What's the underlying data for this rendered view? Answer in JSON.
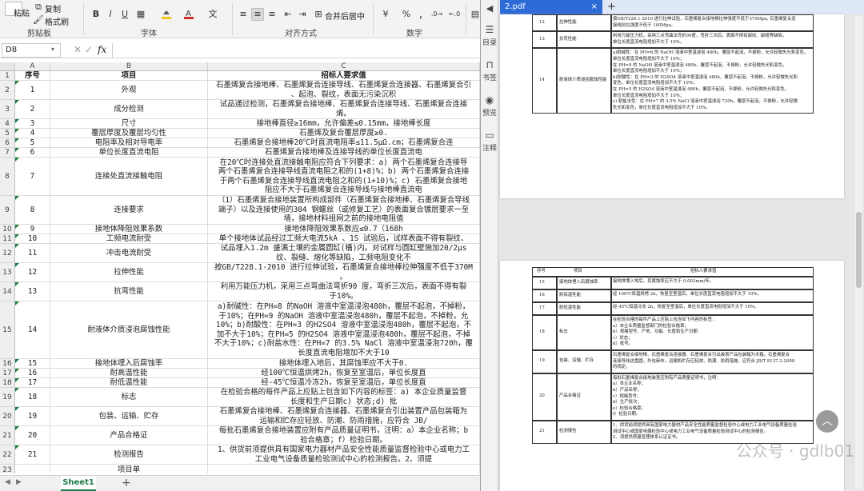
{
  "ribbon": {
    "paste": "粘贴",
    "copy": "复制",
    "format_painter": "格式刷",
    "clipboard_group": "剪贴板",
    "font_group": "字体",
    "align_group": "对齐方式",
    "number_group": "数字",
    "merge": "合并后居中",
    "percent": "%",
    "comma": ",",
    "font_color": "#d02c2c",
    "fill_color": "#f5c518"
  },
  "formula_bar": {
    "cell_ref": "D8",
    "value": ""
  },
  "columns": [
    "A",
    "B",
    "C"
  ],
  "rows": [
    {
      "n": "1",
      "a": "序号",
      "b": "项目",
      "c": "招标人要求值"
    },
    {
      "n": "2",
      "a": "1",
      "b": "外观",
      "c": "石墨烯复合接地棒、石墨烯复合连接导线、石墨烯复合连接器、石墨烯复合引",
      "c2": "、起泡、裂纹，表面无污染沉积"
    },
    {
      "n": "3",
      "a": "2",
      "b": "成分检测",
      "c": "试品通过检测，石墨烯复合接地棒、石墨烯复合连接导线、石墨烯复合连接",
      "c2": "烯。"
    },
    {
      "n": "4",
      "a": "3",
      "b": "尺寸",
      "c": "接地棒直径≥16mm，允许偏差≤0.15mm，接地棒长度"
    },
    {
      "n": "5",
      "a": "4",
      "b": "覆层厚度及覆层均匀性",
      "c": "石墨烯及复合覆层厚度≥0."
    },
    {
      "n": "6",
      "a": "5",
      "b": "电阻率及相对导电率",
      "c": "石墨烯复合接地棒20℃时直流电阻率≤11.5μΩ.cm；石墨烯复合连"
    },
    {
      "n": "7",
      "a": "6",
      "b": "单位长度直流电阻",
      "c": "石墨烯复合接地棒及连接导线的单位长度直流电"
    },
    {
      "n": "8",
      "a": "7",
      "b": "连接处直流接触电阻",
      "c": "在20℃时连接处直流接触电阻应符合下列要求：a) 两个石墨烯复合连接导",
      "c2": "两个石墨烯复合连接导线直流电阻之和的(1+8)%；b) 两个石墨烯复合连接",
      "c3": "于两个石墨烯复合连接导线直流电阻之和的(1+10)%；c) 石墨烯复合接地",
      "c4": "阻应不大于石墨烯复合连接导线与接地棒直流电"
    },
    {
      "n": "9",
      "a": "8",
      "b": "连接要求",
      "c": "（1）石墨烯复合接地装置所构成部件（石墨烯复合接地棒、石墨烯复合导线",
      "c2": "端子）以及连接使用的304 钢螺丝（或修复工艺）的表面复合镀层要求一至",
      "c3": "墙，接地材料组网之前的接地电阻值"
    },
    {
      "n": "10",
      "a": "9",
      "b": "接地体降阻效果系数",
      "c": "接地体降阻效果系数应≤0.7（168h"
    },
    {
      "n": "11",
      "a": "10",
      "b": "工频电流耐受",
      "c": "单个接地体试品经过工频大电流5kA 、1S 试验后，试样表面不得有裂纹、"
    },
    {
      "n": "12",
      "a": "11",
      "b": "冲击电流耐受",
      "c": "试品埋入1.2m 盛满土壤的金属圆缸(桶)内。对试样与圆缸壁施加20/2μs",
      "c2": "纹、裂缝、熔化等缺陷，工频电阻变化不"
    },
    {
      "n": "13",
      "a": "12",
      "b": "拉伸性能",
      "c": "按GB/T228.1-2010 进行拉伸试验，石墨烯复合接地棒拉伸强度不低于370M",
      "c2": "。"
    },
    {
      "n": "14",
      "a": "13",
      "b": "抗弯性能",
      "c": "利用万能压力机，采用三点弯曲法弯折90 度，弯折三次后，表面不得有裂",
      "c2": "于10%。"
    },
    {
      "n": "15",
      "a": "14",
      "b": "耐液体介质浸泡腐蚀性能",
      "c": "a)耐碱性：在PH=8 的NaOH 溶液中室温浸泡480h，覆层不起泡，不掉粉，",
      "c2": "于10%；在PH=9 的NaOH 溶液中室温浸泡480h，覆层不起泡，不掉粉，允",
      "c3": "10%；b)耐酸性：在PH=3 的H2SO4 溶液中室温浸泡480h，覆层不起泡，不",
      "c4": "加不大于10%；在PH=5 的H2SO4 溶液中室温浸泡480h，覆层不起泡，不掉",
      "c5": "不大于10%；c)耐盐水性：在PH=7 的3.5% NaCl 溶液中室温浸泡720h，覆",
      "c6": "长度直流电阻增加不大于10"
    },
    {
      "n": "16",
      "a": "15",
      "b": "接地体埋入后腐蚀率",
      "c": "接地体埋入地后，其腐蚀率应不大于0."
    },
    {
      "n": "17",
      "a": "16",
      "b": "耐高温性能",
      "c": "经100℃恒温烘烤2h，恢复至室温后，单位长度直"
    },
    {
      "n": "18",
      "a": "17",
      "b": "耐低温性能",
      "c": "经-45℃恒温冷冻2h，恢复至室温后，单位长度直"
    },
    {
      "n": "19",
      "a": "18",
      "b": "标志",
      "c": "在检验合格的每件产品上应贴上包含如下内容的标签：a) 本企业质量监督",
      "c2": "长度和生产日期c) 状态;d) 批"
    },
    {
      "n": "20",
      "a": "19",
      "b": "包装、运输、贮存",
      "c": "石墨烯复合接地棒、石墨烯复合连接器、石墨烯复合引出装置产品包装箱为",
      "c2": "运输和贮存应轻放、防潮、防雨措施，应符合 JB/"
    },
    {
      "n": "21",
      "a": "20",
      "b": "产品合格证",
      "c": "每批石墨烯复合接地装置应附有产品质量证明书，注明：a）本企业名称；b",
      "c2": "验合格章；f）检验日期。"
    },
    {
      "n": "22",
      "a": "21",
      "b": "检测报告",
      "c": "1、供货前须提供具有国家电力器材产品安全性能质量监督检验中心或电力工",
      "c2": "工业电气设备质量检验测试中心的检测报告。2、须提"
    },
    {
      "n": "23",
      "a": "",
      "b": "项目单",
      "c": ""
    }
  ],
  "sheet_tab": "Sheet1",
  "pdf": {
    "tab_title": "2.pdf",
    "side": [
      "目录",
      "书签",
      "预览",
      "注释"
    ],
    "page1": [
      {
        "no": "12",
        "item": "拉伸性能",
        "val": [
          "按GB/T228.1-2010 进行拉伸试验，石墨烯复合接地棒拉伸强度不低于370Mpa, 石墨烯复合连",
          "接线抗拉强度不低于 100Mpa。"
        ]
      },
      {
        "no": "13",
        "item": "抗弯性能",
        "val": [
          "利用万能压力机，采用三点弯曲法弯折90度，弯折三次后，表面不得有裂纹、裂缝等缺陷，",
          "单位长度直流电阻增加不大于 10%。"
        ]
      },
      {
        "no": "14",
        "item": "耐液体介质浸泡腐蚀性能",
        "val": [
          "a)耐碱性：在 PH=8 的 NaOH 溶液中室温浸泡 480h，覆层不起泡，不掉粉，允许轻微失光和变色，",
          "单位长度直流电阻增加不大于 10%；",
          "在 PH=9 的 NaOH 溶液中室温浸泡 480h，覆层不起泡，不掉粉，允许轻微失光和变色，",
          "单位长度直流电阻增加不大于 10%；",
          "b)耐酸性：在 PH=3 的 H2SO4 溶液中室温浸泡 480h，覆层不起泡，不掉粉，允许轻微失光和",
          "变色，单位长度直流电阻增加不大于 10%；",
          "在 PH=5 的 H2SO4 溶液中室温浸泡 480h，覆层不起泡，不掉粉，允许轻微失光和变色，",
          "单位长度直流电阻增加不大于 10%；",
          "c) 耐盐水性：在 PH=7 的 3.5% NaCl 溶液中室温浸泡 720h，覆层不起泡，不掉粉，允许轻微",
          "失光和变色，单位长度直流电阻增加不大于 10%。"
        ]
      }
    ],
    "page2_header": {
      "no": "序号",
      "item": "项目",
      "val": "招标人要求值"
    },
    "page2": [
      {
        "no": "15",
        "item": "接地体埋入后腐蚀率",
        "val": [
          "接地体埋入地后，其腐蚀率应不大于 0.002mm/年。"
        ]
      },
      {
        "no": "16",
        "item": "耐高温性能",
        "val": [
          "经 100℃恒温烘烤 2h，恢复至室温后，单位长度直流电阻增加不大于 10%。"
        ]
      },
      {
        "no": "17",
        "item": "耐低温性能",
        "val": [
          "经-45℃恒温冷冻 2h，恢复至室温后，单位长度直流电阻增加不大于 10%。"
        ]
      },
      {
        "no": "18",
        "item": "标志",
        "val": [
          "在检验合格的每件产品上应贴上包含如下内容的标签：",
          "a）本企业质量监督部门的检验合格章；",
          "b）规格型号、产地、功能、长度和生产日期",
          "c）状态；",
          "d）批号。"
        ]
      },
      {
        "no": "19",
        "item": "包装、运输、贮存",
        "val": [
          "石墨烯复合接地棒、石墨烯复合连接器、石墨烯复合引出装置产品包装箱为木箱，石墨烯复合",
          "连接导线这盘圆，外包麻布。运输和贮存应轻放、防潮、防雨措施，应符合 JB/T 8137.2-2008",
          "的规定。"
        ]
      },
      {
        "no": "20",
        "item": "产品合格证",
        "val": [
          "每批石墨烯复合接地装置应附有产品质量证明书，注明：",
          "a）本企业名称；",
          "b）产品名称；",
          "c）规格型号；",
          "d）生产批次；",
          "e）检验合格章；",
          "f）检验日期。"
        ]
      },
      {
        "no": "21",
        "item": "检测报告",
        "val": [
          "1、供货前须提供具有国家电力器材产品安全性能质量监督检验中心或电力工业电气设备质量检验",
          "测试中心或国家电器检验中心或电力工业电气设备质量检验测试中心的检测报告。",
          "2、须提供质量管理体系认证证书。"
        ]
      }
    ],
    "watermark": "公众号 · gdlb01"
  }
}
